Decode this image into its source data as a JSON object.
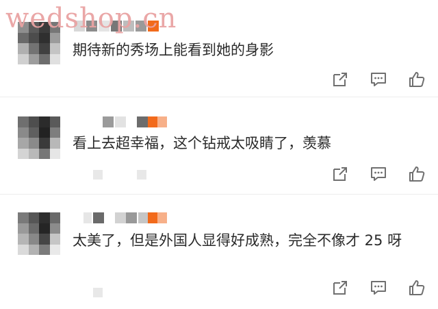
{
  "watermark": {
    "text": "wedshop.cn"
  },
  "colors": {
    "accent_orange": "#f26a1b",
    "gray_dark": "#6e6e6e",
    "gray_mid": "#a8a8a8",
    "gray_light": "#d6d6d6",
    "icon": "#6f6f6f"
  },
  "comments": [
    {
      "text": "期待新的秀场上能看到她的身影",
      "actions": [
        "share-icon",
        "reply-icon",
        "like-icon"
      ]
    },
    {
      "text": "看上去超幸福，这个钻戒太吸睛了，羡慕",
      "actions": [
        "share-icon",
        "reply-icon",
        "like-icon"
      ]
    },
    {
      "text": "太美了，但是外国人显得好成熟，完全不像才 25 呀",
      "actions": [
        "share-icon",
        "reply-icon",
        "like-icon"
      ]
    }
  ]
}
